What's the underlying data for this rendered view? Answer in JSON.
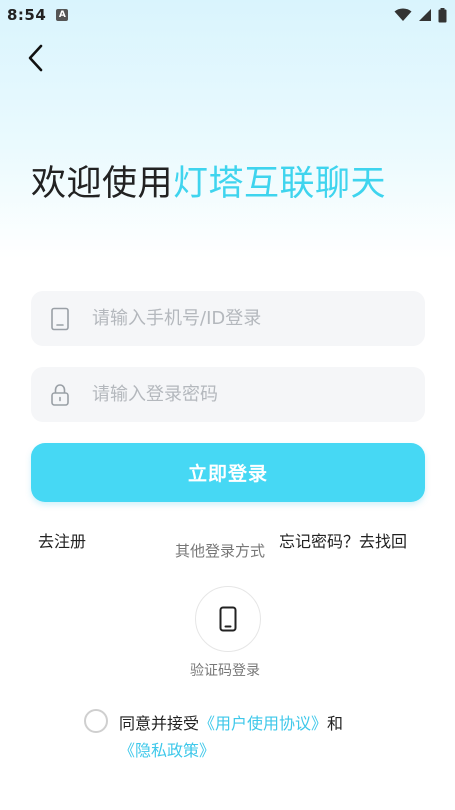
{
  "status_bar": {
    "time": "8:54",
    "notification_badge": "A",
    "icons": [
      "wifi-icon",
      "signal-icon",
      "battery-icon"
    ]
  },
  "headline": {
    "prefix": "欢迎使用",
    "brand": "灯塔互联聊天"
  },
  "phone_field": {
    "placeholder": "请输入手机号/ID登录",
    "value": ""
  },
  "password_field": {
    "placeholder": "请输入登录密码",
    "value": ""
  },
  "login_button": {
    "label": "立即登录"
  },
  "register_link": "去注册",
  "forgot_link": "忘记密码？去找回",
  "other_login": {
    "title": "其他登录方式",
    "sms_label": "验证码登录"
  },
  "agreement": {
    "prefix": "同意并接受",
    "user_agreement": "《用户使用协议》",
    "conjunction": "和",
    "privacy_policy": "《隐私政策》",
    "checked": false
  },
  "colors": {
    "accent": "#46d8f4",
    "brand_text": "#3fd4ee",
    "link": "#3fc8ea"
  }
}
